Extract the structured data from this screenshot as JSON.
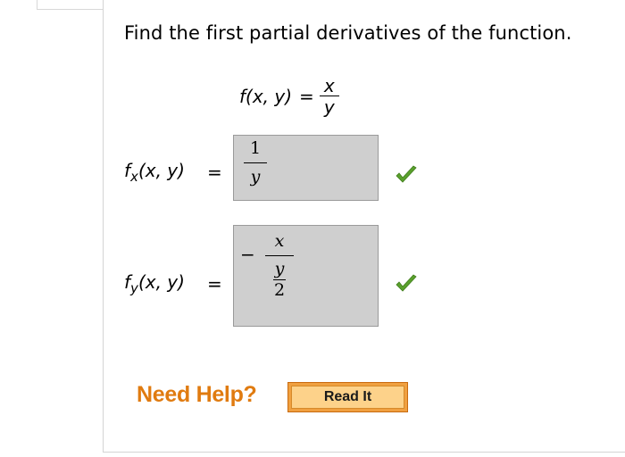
{
  "question": {
    "prompt": "Find the first partial derivatives of the function.",
    "function": {
      "lhs": "f(x, y)",
      "eq": "=",
      "numerator": "x",
      "denominator": "y"
    }
  },
  "answers": [
    {
      "fn": "f",
      "sub": "x",
      "args": "(x, y)",
      "eq": "=",
      "numerator": "1",
      "denominator": "y",
      "status": "correct"
    },
    {
      "fn": "f",
      "sub": "y",
      "args": "(x, y)",
      "eq": "=",
      "sign": "−",
      "numerator": "x",
      "denominator_numerator": "y",
      "denominator_denominator": "2",
      "status": "correct"
    }
  ],
  "help": {
    "label": "Need Help?",
    "read_it_label": "Read It"
  },
  "colors": {
    "check": "#5aa02c",
    "need_help": "#e07b10",
    "button_bg": "#fdd28a",
    "answer_box": "#cfcfcf"
  }
}
